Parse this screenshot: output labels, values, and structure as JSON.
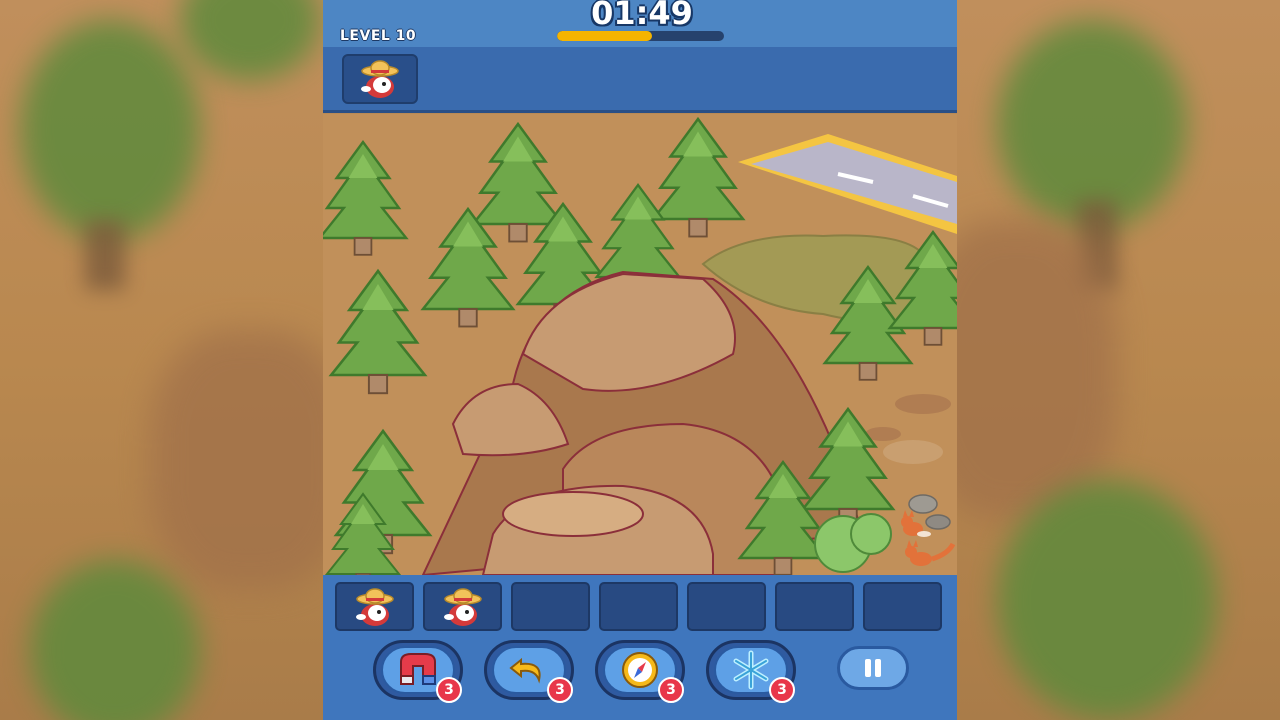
{
  "header": {
    "level_label": "LEVEL 10",
    "timer": "01:49",
    "time_remaining_fraction": 0.57,
    "time_bar_color": "#f5b400"
  },
  "target": {
    "item_icon": "straw-hat-bird-icon"
  },
  "tray": {
    "slots": [
      {
        "filled": true,
        "icon": "straw-hat-bird-icon"
      },
      {
        "filled": true,
        "icon": "straw-hat-bird-icon"
      },
      {
        "filled": false
      },
      {
        "filled": false
      },
      {
        "filled": false
      },
      {
        "filled": false
      },
      {
        "filled": false
      }
    ]
  },
  "tools": [
    {
      "name": "magnet",
      "icon": "magnet-icon",
      "count": "3"
    },
    {
      "name": "undo",
      "icon": "undo-arrow-icon",
      "count": "3"
    },
    {
      "name": "compass",
      "icon": "compass-icon",
      "count": "3"
    },
    {
      "name": "freeze",
      "icon": "snowflake-icon",
      "count": "3"
    }
  ],
  "pause": {
    "icon": "pause-icon"
  },
  "colors": {
    "header_blue": "#4d86c4",
    "tray_blue": "#3f76bd",
    "badge_red": "#e8364a"
  }
}
